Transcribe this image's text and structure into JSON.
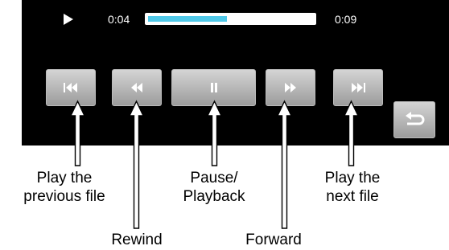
{
  "player": {
    "elapsed": "0:04",
    "total": "0:09",
    "progress_fraction": 0.48
  },
  "buttons": {
    "previous": {
      "icon": "skip-previous-icon"
    },
    "rewind": {
      "icon": "rewind-icon"
    },
    "pause": {
      "icon": "pause-icon"
    },
    "forward": {
      "icon": "fast-forward-icon"
    },
    "next": {
      "icon": "skip-next-icon"
    },
    "back": {
      "icon": "return-icon"
    }
  },
  "callouts": {
    "previous": "Play the\nprevious file",
    "pause": "Pause/\nPlayback",
    "next": "Play the\nnext file",
    "rewind": "Rewind",
    "forward": "Forward"
  },
  "colors": {
    "screen": "#000000",
    "progress": "#4fc8e8",
    "button": "#bdbdbd"
  }
}
